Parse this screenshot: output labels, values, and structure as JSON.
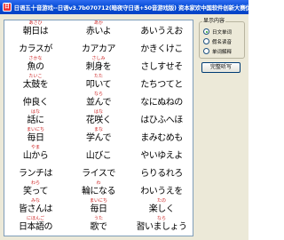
{
  "window": {
    "title": "日语五十音游戏--日语v3.7b070712(暗夜守日语+50音游戏版)  资本家欢中国软件创新大赛优秀作品奖!"
  },
  "options": {
    "group_title": "显示内容",
    "radios": [
      {
        "label": "日文单词",
        "checked": true
      },
      {
        "label": "假名读音",
        "checked": false
      },
      {
        "label": "单词解释",
        "checked": false
      }
    ],
    "button_label": "完整听写"
  },
  "words": [
    {
      "ruby": "あさひ",
      "text": "朝日は"
    },
    {
      "ruby": "あか",
      "text": "赤いよ"
    },
    {
      "ruby": "",
      "text": "あいうえお"
    },
    {
      "ruby": "",
      "text": "カラスが"
    },
    {
      "ruby": "",
      "text": "カアカア"
    },
    {
      "ruby": "",
      "text": "かきくけこ"
    },
    {
      "ruby": "さかな",
      "text": "魚の"
    },
    {
      "ruby": "さしみ",
      "text": "刺身を"
    },
    {
      "ruby": "",
      "text": "さしすせそ"
    },
    {
      "ruby": "たいこ",
      "text": "太鼓を"
    },
    {
      "ruby": "たた",
      "text": "叩いて"
    },
    {
      "ruby": "",
      "text": "たちつてと"
    },
    {
      "ruby": "",
      "text": "仲良く"
    },
    {
      "ruby": "なら",
      "text": "並んで"
    },
    {
      "ruby": "",
      "text": "なにぬねの"
    },
    {
      "ruby": "はな",
      "text": "話に"
    },
    {
      "ruby": "はな",
      "text": "花咲く"
    },
    {
      "ruby": "",
      "text": "はひふへほ"
    },
    {
      "ruby": "まいにち",
      "text": "毎日"
    },
    {
      "ruby": "まな",
      "text": "学んで"
    },
    {
      "ruby": "",
      "text": "まみむめも"
    },
    {
      "ruby": "やま",
      "text": "山から"
    },
    {
      "ruby": "",
      "text": "山びこ"
    },
    {
      "ruby": "",
      "text": "やいゆえよ"
    },
    {
      "ruby": "",
      "text": "ランチは"
    },
    {
      "ruby": "",
      "text": "ライスで"
    },
    {
      "ruby": "",
      "text": "らりるれろ"
    },
    {
      "ruby": "わら",
      "text": "笑って"
    },
    {
      "ruby": "わ",
      "text": "輪になる"
    },
    {
      "ruby": "",
      "text": "わいうえを"
    },
    {
      "ruby": "みな",
      "text": "皆さんは"
    },
    {
      "ruby": "まいにち",
      "text": "毎日"
    },
    {
      "ruby": "たの",
      "text": "楽しく"
    },
    {
      "ruby": "にほんご",
      "text": "日本語の"
    },
    {
      "ruby": "うた",
      "text": "歌で"
    },
    {
      "ruby": "なら",
      "text": "習いましょう"
    }
  ]
}
